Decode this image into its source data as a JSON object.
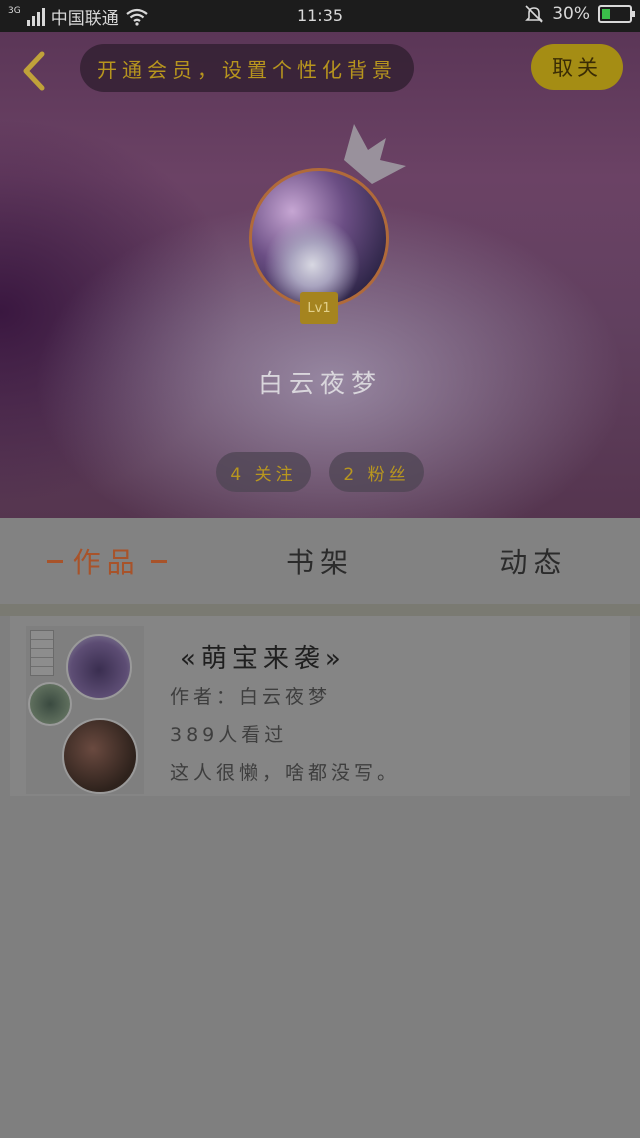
{
  "status_bar": {
    "network": "3G",
    "carrier": "中国联通",
    "time": "11:35",
    "battery": "30%",
    "battery_level": 0.3,
    "icons": [
      "signal-icon",
      "wifi-icon",
      "mute-bell-icon",
      "battery-icon"
    ]
  },
  "header": {
    "vip_banner": "开通会员，设置个性化背景",
    "cancel_label": "取关",
    "level_badge": "Lv1",
    "username": "白云夜梦",
    "following": "4 关注",
    "followers": "2 粉丝"
  },
  "tabs": [
    {
      "label": "作品",
      "active": true
    },
    {
      "label": "书架",
      "active": false
    },
    {
      "label": "动态",
      "active": false
    }
  ],
  "works": [
    {
      "title": "«萌宝来袭»",
      "author": "作者：白云夜梦",
      "views": "389人看过",
      "description": "这人很懒，啥都没写。"
    }
  ],
  "colors": {
    "accent_gold": "#b8961f",
    "active_tab": "#a8532a",
    "overlay_gray": "#7f7f7f"
  }
}
